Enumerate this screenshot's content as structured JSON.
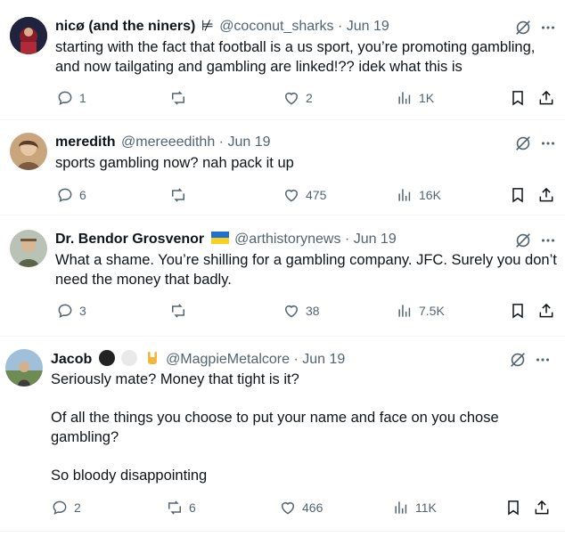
{
  "tweets": [
    {
      "name": "nicø (and the niners)",
      "name_suffix": "⊭",
      "handle": "@coconut_sharks",
      "date": "Jun 19",
      "text": "starting with the fact that football is a us sport, you’re promoting gambling,\nand now tailgating and gambling are linked!?? idek what this is",
      "replies": "1",
      "reposts": "",
      "likes": "2",
      "views": "1K"
    },
    {
      "name": "meredith",
      "name_suffix": "",
      "handle": "@mereeedithh",
      "date": "Jun 19",
      "text": "sports gambling now? nah pack it up",
      "replies": "6",
      "reposts": "",
      "likes": "475",
      "views": "16K"
    },
    {
      "name": "Dr. Bendor Grosvenor",
      "name_suffix": "",
      "handle": "@arthistorynews",
      "date": "Jun 19",
      "text": "What a shame. You’re shilling for a gambling company. JFC. Surely you don’t\nneed the money that badly.",
      "replies": "3",
      "reposts": "",
      "likes": "38",
      "views": "7.5K"
    },
    {
      "name": "Jacob",
      "name_suffix": "",
      "handle": "@MagpieMetalcore",
      "date": "Jun 19",
      "text": "Seriously mate? Money that tight is it?\n\nOf all the things you choose to put your name and face on you chose\ngambling?\n\nSo bloody disappointing",
      "replies": "2",
      "reposts": "6",
      "likes": "466",
      "views": "11K"
    }
  ],
  "separator": "·",
  "colors": {
    "text": "#0f1419",
    "muted": "#536471",
    "border": "#eff3f4"
  },
  "icons": [
    "reply-icon",
    "repost-icon",
    "like-icon",
    "views-icon",
    "bookmark-icon",
    "share-icon",
    "grok-icon",
    "more-icon"
  ]
}
